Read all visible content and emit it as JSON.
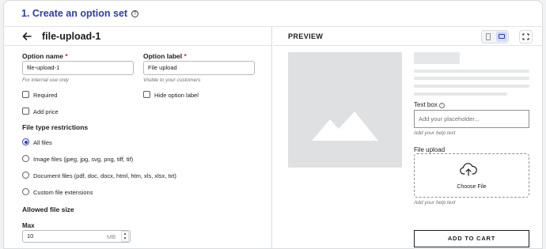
{
  "header": {
    "title": "1. Create an option set",
    "help_icon": "question-circle-icon"
  },
  "editor": {
    "set_name": "file-upload-1",
    "back_icon": "arrow-left-icon",
    "option_name": {
      "label": "Option name",
      "required": "*",
      "value": "file-upload-1",
      "hint": "For internal use only"
    },
    "option_label": {
      "label": "Option label",
      "required": "*",
      "value": "File upload",
      "hint": "Visible to your customers"
    },
    "required_checkbox": {
      "label": "Required",
      "checked": false
    },
    "hide_label_checkbox": {
      "label": "Hide option label",
      "checked": false
    },
    "add_price_checkbox": {
      "label": "Add price",
      "checked": false
    },
    "file_types": {
      "title": "File type restrictions",
      "options": [
        {
          "label": "All files",
          "selected": true
        },
        {
          "label": "Image files (jpeg, jpg, svg, png, tiff, tif)",
          "selected": false
        },
        {
          "label": "Document files (pdf, doc, docx, html, htm, xls, xlsx, txt)",
          "selected": false
        },
        {
          "label": "Custom file extensions",
          "selected": false
        }
      ]
    },
    "file_size": {
      "title": "Allowed file size",
      "max_label": "Max",
      "max_value": "10",
      "unit": "MB"
    }
  },
  "preview": {
    "title": "PREVIEW",
    "device_selected": "desktop",
    "text_box": {
      "label": "Text box",
      "placeholder": "Add your placeholder...",
      "hint": "Add your help text"
    },
    "file_upload": {
      "label": "File upload",
      "button": "Choose File",
      "hint": "Add your help text",
      "icon": "cloud-upload-icon"
    },
    "cart_button": "ADD TO CART"
  },
  "colors": {
    "accent": "#2c3fa8",
    "required": "#d72c0d",
    "skeleton": "#e6e7e9"
  }
}
